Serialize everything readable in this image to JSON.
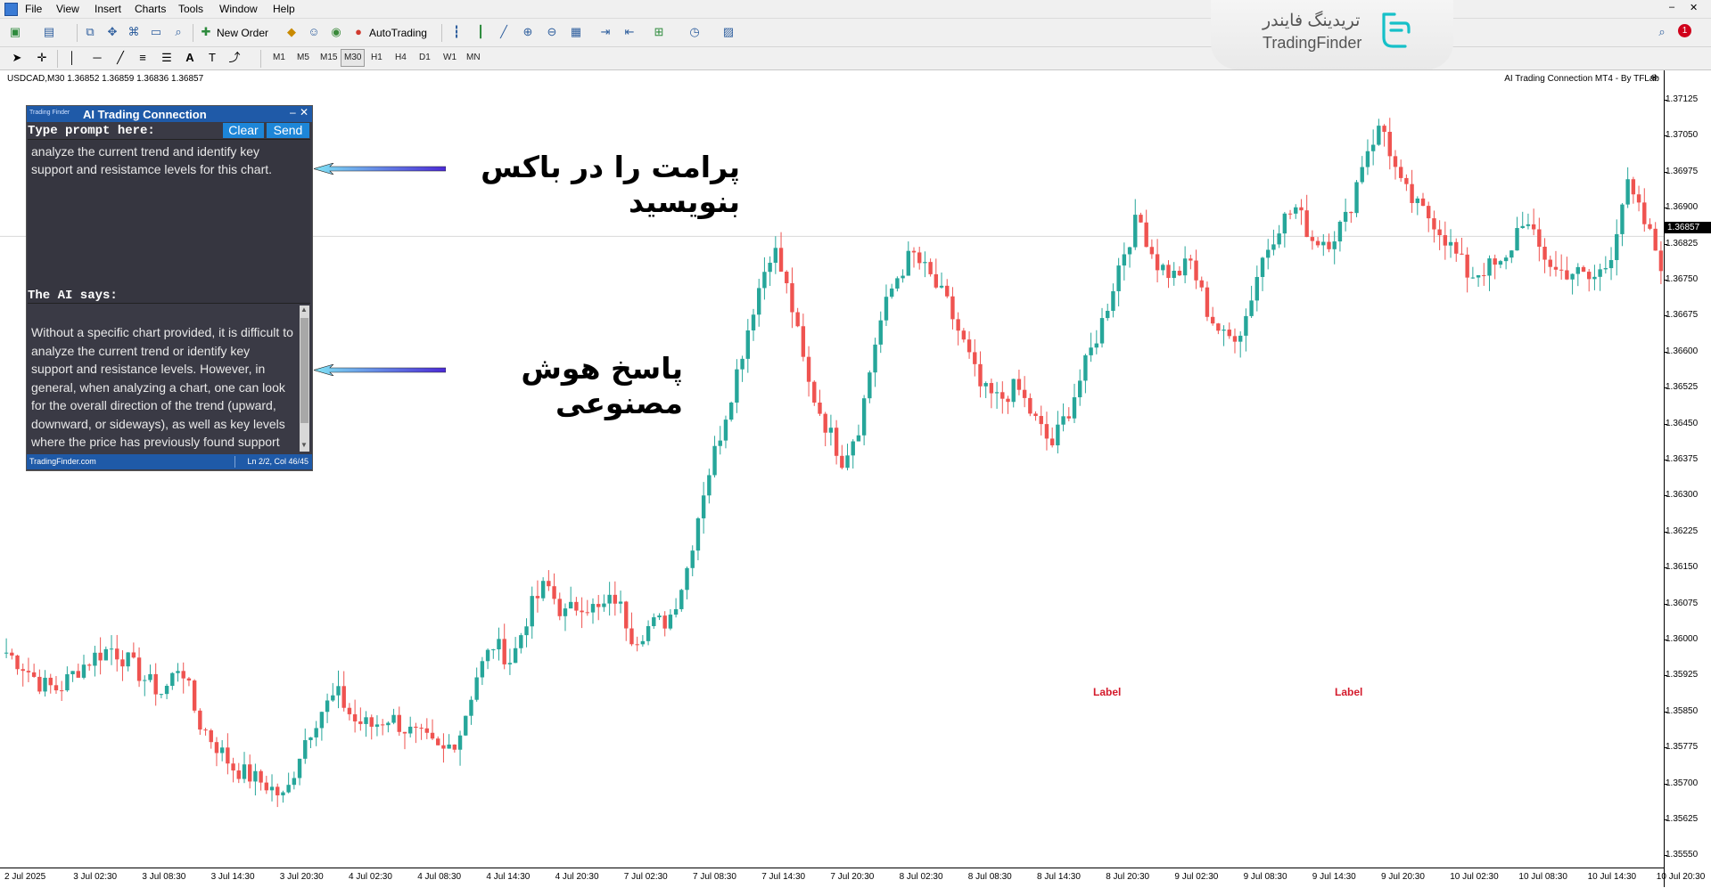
{
  "menu": {
    "items": [
      "File",
      "View",
      "Insert",
      "Charts",
      "Tools",
      "Window",
      "Help"
    ]
  },
  "toolbar": {
    "new_order_label": "New Order",
    "autotrading_label": "AutoTrading",
    "timeframes": [
      "M1",
      "M5",
      "M15",
      "M30",
      "H1",
      "H4",
      "D1",
      "W1",
      "MN"
    ],
    "active_timeframe": "M30",
    "notification_count": "1"
  },
  "logo": {
    "fa": "تریدینگ فایندر",
    "en": "TradingFinder"
  },
  "chart": {
    "symbol_info": "USDCAD,M30  1.36852 1.36859 1.36836 1.36857",
    "indicator_title": "AI Trading Connection MT4 - By TFLab",
    "current_price": "1.36857",
    "labels": [
      "Label",
      "Label"
    ]
  },
  "panel": {
    "brand_small": "Trading Finder",
    "title": "AI Trading Connection",
    "prompt_label": "Type prompt here:",
    "clear_label": "Clear",
    "send_label": "Send",
    "prompt_text": "analyze the current trend and identify key support and resistamce levels for this chart.",
    "ai_says_label": "The AI says:",
    "answer_text": "Without a specific chart provided, it is difficult to analyze the current trend or identify key support and resistance levels. However, in general, when analyzing a chart, one can look for the overall direction of the trend (upward, downward, or sideways), as well as key levels where the price has previously found support",
    "status_left": "TradingFinder.com",
    "status_right": "Ln 2/2, Col 46/45"
  },
  "annotations": {
    "prompt_annotation": "پرامت را در باکس بنویسید",
    "answer_annotation": "پاسخ هوش مصنوعی"
  },
  "colors": {
    "bull": "#26a69a",
    "bear": "#ef5350",
    "panel_bg": "#3a3a45",
    "panel_header": "#1f5aa8",
    "button": "#1d86d8",
    "label_red": "#d41b2c"
  },
  "chart_data": {
    "type": "candlestick",
    "symbol": "USDCAD",
    "timeframe": "M30",
    "y_ticks": [
      "1.37125",
      "1.37050",
      "1.36975",
      "1.36900",
      "1.36825",
      "1.36750",
      "1.36675",
      "1.36600",
      "1.36525",
      "1.36450",
      "1.36375",
      "1.36300",
      "1.36225",
      "1.36150",
      "1.36075",
      "1.36000",
      "1.35925",
      "1.35850",
      "1.35775",
      "1.35700",
      "1.35625",
      "1.35550"
    ],
    "x_ticks": [
      "2 Jul 2025",
      "3 Jul 02:30",
      "3 Jul 08:30",
      "3 Jul 14:30",
      "3 Jul 20:30",
      "4 Jul 02:30",
      "4 Jul 08:30",
      "4 Jul 14:30",
      "4 Jul 20:30",
      "7 Jul 02:30",
      "7 Jul 08:30",
      "7 Jul 14:30",
      "7 Jul 20:30",
      "8 Jul 02:30",
      "8 Jul 08:30",
      "8 Jul 14:30",
      "8 Jul 20:30",
      "9 Jul 02:30",
      "9 Jul 08:30",
      "9 Jul 14:30",
      "9 Jul 20:30",
      "10 Jul 02:30",
      "10 Jul 08:30",
      "10 Jul 14:30",
      "10 Jul 20:30"
    ],
    "ylim": [
      1.3552,
      1.3718
    ],
    "close_path": [
      1.3595,
      1.3592,
      1.3588,
      1.3587,
      1.3591,
      1.3594,
      1.3596,
      1.3593,
      1.3589,
      1.3586,
      1.3593,
      1.358,
      1.3575,
      1.357,
      1.3568,
      1.3566,
      1.3563,
      1.3575,
      1.3582,
      1.3586,
      1.358,
      1.3579,
      1.3581,
      1.3578,
      1.3576,
      1.3573,
      1.3577,
      1.359,
      1.3597,
      1.3593,
      1.3604,
      1.361,
      1.3603,
      1.3606,
      1.3604,
      1.3607,
      1.3598,
      1.3601,
      1.3602,
      1.3612,
      1.363,
      1.3643,
      1.3657,
      1.3672,
      1.3684,
      1.3672,
      1.3654,
      1.3645,
      1.3637,
      1.3645,
      1.3665,
      1.3676,
      1.3682,
      1.3677,
      1.3671,
      1.3662,
      1.3652,
      1.365,
      1.3653,
      1.3646,
      1.364,
      1.3648,
      1.3658,
      1.3668,
      1.3681,
      1.369,
      1.368,
      1.3677,
      1.368,
      1.3669,
      1.3663,
      1.3666,
      1.368,
      1.3688,
      1.3692,
      1.3685,
      1.3685,
      1.369,
      1.3704,
      1.371,
      1.3697,
      1.3692,
      1.3689,
      1.3683,
      1.3677,
      1.3679,
      1.3679,
      1.369,
      1.3683,
      1.3678,
      1.3678,
      1.3676,
      1.368,
      1.3697,
      1.3689,
      1.368
    ]
  }
}
